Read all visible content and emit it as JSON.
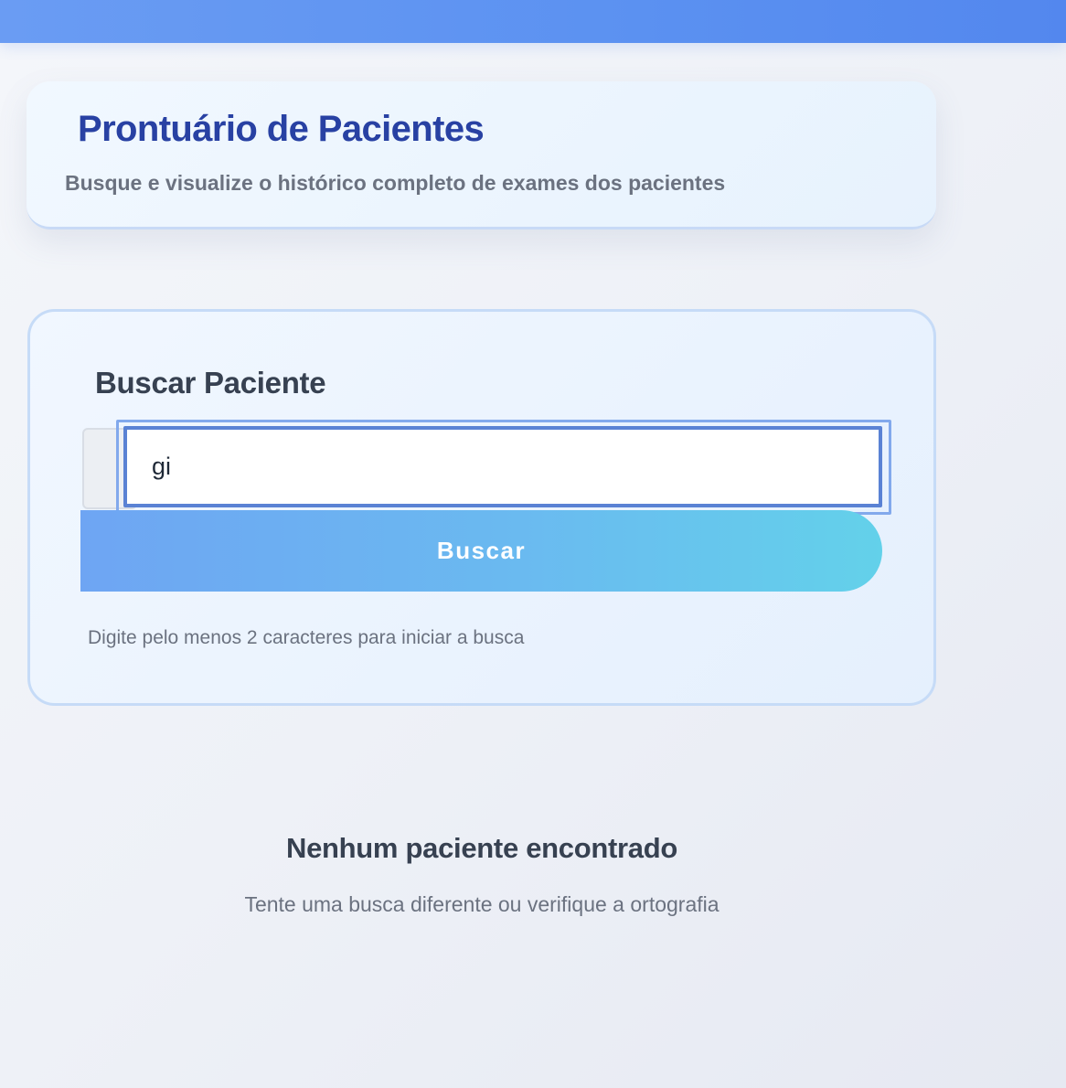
{
  "header": {
    "title": "Prontuário de Pacientes",
    "subtitle": "Busque e visualize o histórico completo de exames dos pacientes"
  },
  "search": {
    "title": "Buscar Paciente",
    "value": "gi",
    "button_label": "Buscar",
    "hint": "Digite pelo menos 2 caracteres para iniciar a busca"
  },
  "empty_state": {
    "title": "Nenhum paciente encontrado",
    "text": "Tente uma busca diferente ou verifique a ortografia"
  },
  "colors": {
    "accent": "#5b91f1",
    "title": "#2841a3",
    "button_start": "#6ea5f3",
    "button_end": "#63d1ea"
  }
}
